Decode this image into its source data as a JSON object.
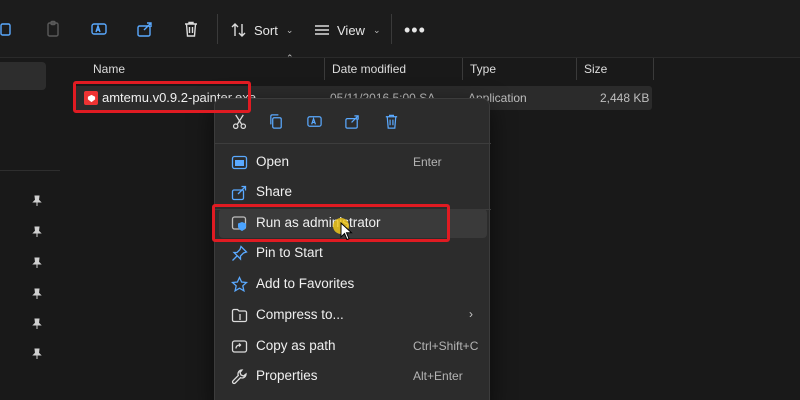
{
  "toolbar": {
    "sort_label": "Sort",
    "view_label": "View",
    "more_label": "•••"
  },
  "columns": {
    "name": "Name",
    "date": "Date modified",
    "type": "Type",
    "size": "Size"
  },
  "file": {
    "name": "amtemu.v0.9.2-painter.exe",
    "date": "05/11/2016 5:00 SA",
    "type": "Application",
    "size": "2,448 KB"
  },
  "context_menu": {
    "items": [
      {
        "label": "Open",
        "shortcut": "Enter",
        "icon": "open-icon"
      },
      {
        "label": "Share",
        "shortcut": "",
        "icon": "share-icon"
      },
      {
        "label": "Run as administrator",
        "shortcut": "",
        "icon": "shield-icon"
      },
      {
        "label": "Pin to Start",
        "shortcut": "",
        "icon": "pin-icon"
      },
      {
        "label": "Add to Favorites",
        "shortcut": "",
        "icon": "star-icon"
      },
      {
        "label": "Compress to...",
        "shortcut": "",
        "icon": "zip-icon",
        "submenu": "›"
      },
      {
        "label": "Copy as path",
        "shortcut": "Ctrl+Shift+C",
        "icon": "path-icon"
      },
      {
        "label": "Properties",
        "shortcut": "Alt+Enter",
        "icon": "wrench-icon"
      }
    ]
  },
  "colors": {
    "highlight_box": "#e01b22",
    "menu_bg": "#2c2c2c",
    "window_bg": "#191919"
  }
}
